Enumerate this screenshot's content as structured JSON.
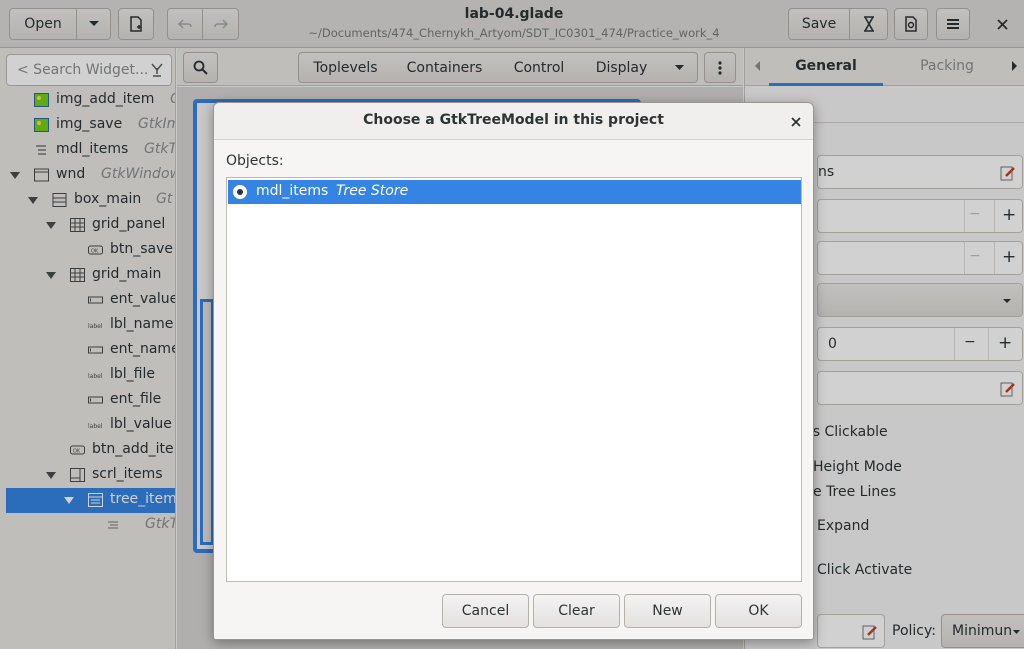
{
  "header": {
    "open_label": "Open",
    "title": "lab-04.glade",
    "subtitle": "~/Documents/474_Chernykh_Artyom/SDT_IC0301_474/Practice_work_4",
    "save_label": "Save"
  },
  "left_panel": {
    "search_placeholder": "< Search Widget...",
    "tree": [
      {
        "name": "img_add_item",
        "type": "G"
      },
      {
        "name": "img_save",
        "type": "GtkIm"
      },
      {
        "name": "mdl_items",
        "type": "GtkT"
      },
      {
        "name": "wnd",
        "type": "GtkWindow"
      },
      {
        "name": "box_main",
        "type": "Gt"
      },
      {
        "name": "grid_panel",
        "type": ""
      },
      {
        "name": "btn_save",
        "type": ""
      },
      {
        "name": "grid_main",
        "type": ""
      },
      {
        "name": "ent_value",
        "type": ""
      },
      {
        "name": "lbl_name",
        "type": ""
      },
      {
        "name": "ent_name",
        "type": ""
      },
      {
        "name": "lbl_file",
        "type": ""
      },
      {
        "name": "ent_file",
        "type": ""
      },
      {
        "name": "lbl_value",
        "type": ""
      },
      {
        "name": "btn_add_ite",
        "type": ""
      },
      {
        "name": "scrl_items",
        "type": ""
      },
      {
        "name": "tree_item",
        "type": ""
      },
      {
        "name": "",
        "type": "GtkT"
      }
    ]
  },
  "palette": {
    "tabs": [
      "Toplevels",
      "Containers",
      "Control",
      "Display"
    ]
  },
  "right_panel": {
    "tab_general": "General",
    "tab_packing": "Packing",
    "field_model_value": "ns",
    "field_number_value": "0",
    "opt_clickable": "rs Clickable",
    "opt_height_mode": "Height Mode",
    "opt_tree_lines": "e Tree Lines",
    "opt_expand": "Expand",
    "opt_click_activate": "Click Activate",
    "policy_label": "Policy:",
    "policy_value": "Minimun"
  },
  "dialog": {
    "title": "Choose a GtkTreeModel in this project",
    "objects_label": "Objects:",
    "object_name": "mdl_items",
    "object_type": "Tree Store",
    "buttons": {
      "cancel": "Cancel",
      "clear": "Clear",
      "new": "New",
      "ok": "OK"
    }
  },
  "colors": {
    "selection": "#3584e4",
    "header_bg": "#dddbd8"
  }
}
